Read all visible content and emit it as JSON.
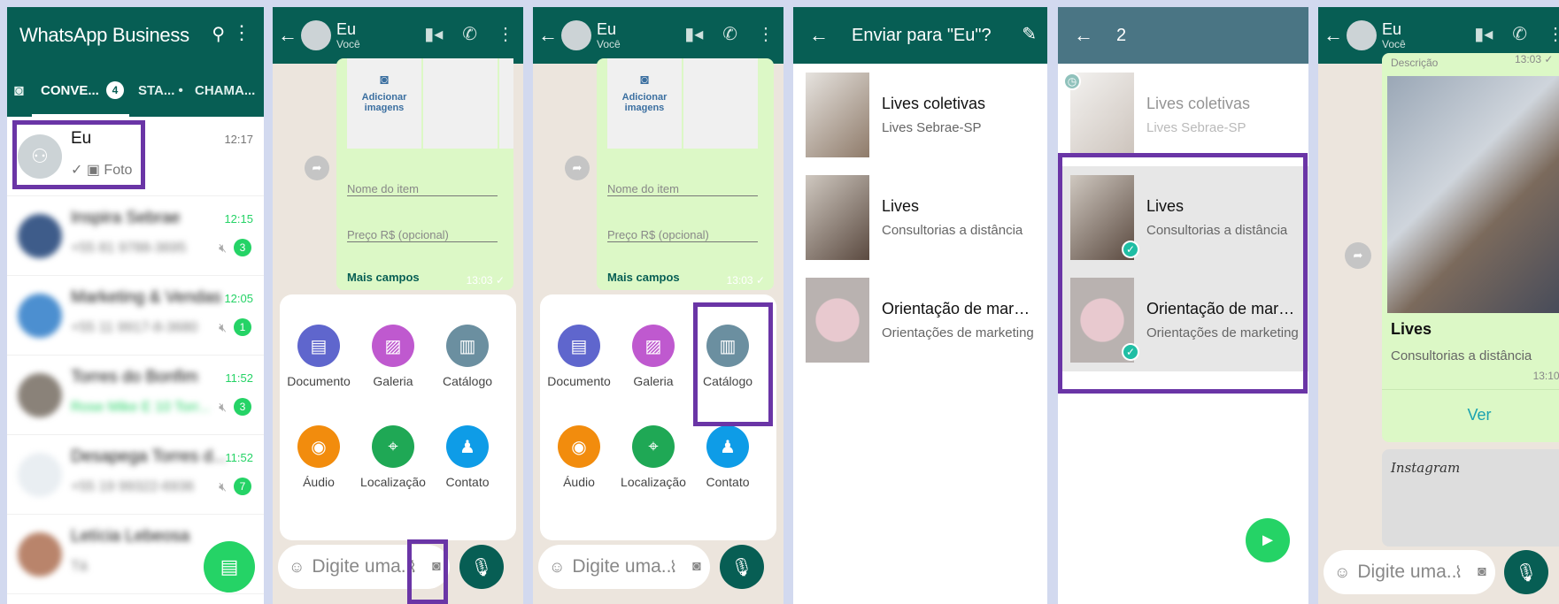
{
  "chat_list": {
    "app_title": "WhatsApp Business",
    "tab_conversas": "CONVE...",
    "tab_badge": "4",
    "tab_status": "STA... •",
    "tab_chamadas": "CHAMA...",
    "chats": [
      {
        "name": "Eu",
        "preview": "✓ ▣ Foto",
        "time": "12:17",
        "count": ""
      },
      {
        "name": "Inspira Sebrae",
        "preview": "+55 81 9788-3695",
        "time": "12:15",
        "count": "3"
      },
      {
        "name": "Marketing & Vendas",
        "preview": "+55 11 9917-8-3680",
        "time": "12:05",
        "count": "1"
      },
      {
        "name": "Torres do Bonfim",
        "preview": "Rose Mike E 10 Torr...",
        "time": "11:52",
        "count": "3"
      },
      {
        "name": "Desapega Torres d...",
        "preview": "+55 19 99322-6936",
        "time": "11:52",
        "count": "7"
      },
      {
        "name": "Letícia Lebeosa",
        "preview": "Tá",
        "time": "",
        "count": ""
      }
    ]
  },
  "chat": {
    "name": "Eu",
    "subtitle": "Você",
    "add_images": "Adicionar imagens",
    "item_name_placeholder": "Nome do item",
    "price_placeholder": "Preço R$ (opcional)",
    "more_fields": "Mais campos",
    "time": "13:03 ✓",
    "input_placeholder": "Digite uma...",
    "attach": [
      {
        "label": "Documento",
        "color": "#5f66cd"
      },
      {
        "label": "Galeria",
        "color": "#bf59cf"
      },
      {
        "label": "Catálogo",
        "color": "#6b8fa0"
      },
      {
        "label": "Áudio",
        "color": "#f28c0d"
      },
      {
        "label": "Localização",
        "color": "#1fa855"
      },
      {
        "label": "Contato",
        "color": "#0e9ce7"
      }
    ]
  },
  "send_to": {
    "title": "Enviar para \"Eu\"?",
    "items": [
      {
        "name": "Lives coletivas",
        "desc": "Lives Sebrae-SP"
      },
      {
        "name": "Lives",
        "desc": "Consultorias a distância"
      },
      {
        "name": "Orientação de market...",
        "desc": "Orientações de marketing"
      }
    ]
  },
  "selection": {
    "count": "2",
    "items": [
      {
        "name": "Lives coletivas",
        "desc": "Lives Sebrae-SP"
      },
      {
        "name": "Lives",
        "desc": "Consultorias a distância"
      },
      {
        "name": "Orientação de market...",
        "desc": "Orientações de marketing"
      }
    ]
  },
  "result": {
    "name": "Eu",
    "subtitle": "Você",
    "description_cut": "Descrição",
    "time_top": "13:03 ✓",
    "product_title": "Lives",
    "product_desc": "Consultorias a distância",
    "time": "13:10 ✓",
    "view": "Ver",
    "second_card": "Instagram",
    "input_placeholder": "Digite uma..."
  }
}
